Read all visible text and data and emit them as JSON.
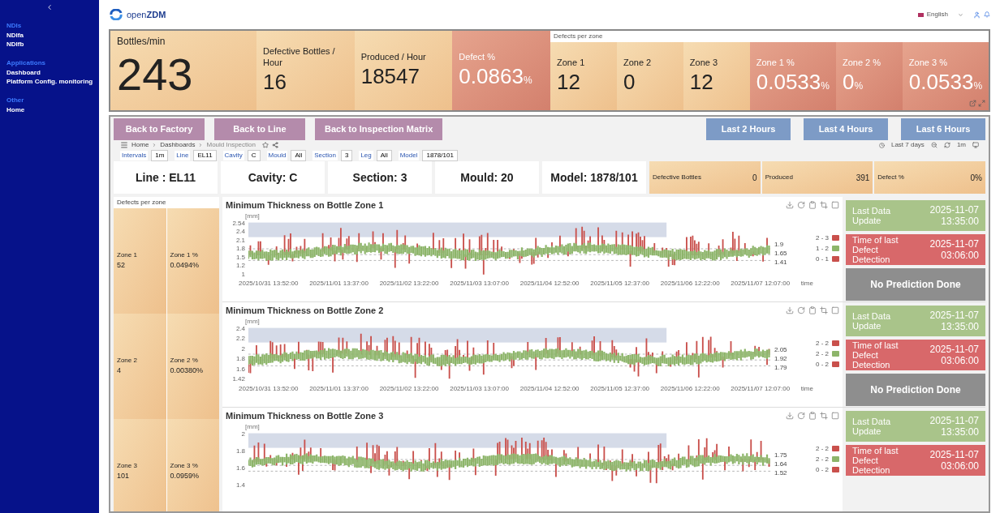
{
  "sidebar": {
    "sections": [
      {
        "title": "NDIs",
        "items": [
          "NDIfa",
          "NDIfb"
        ]
      },
      {
        "title": "Applications",
        "items": [
          "Dashboard",
          "Platform Config. monitoring"
        ]
      },
      {
        "title": "Other",
        "items": [
          "Home"
        ]
      }
    ]
  },
  "header": {
    "logo_light": "open",
    "logo_bold": "ZDM",
    "language": "English"
  },
  "kpis": {
    "main": {
      "label": "Bottles/min",
      "value": "243"
    },
    "tiles": [
      {
        "label": "Defective Bottles / Hour",
        "value": "16",
        "kind": "light"
      },
      {
        "label": "Produced / Hour",
        "value": "18547",
        "kind": "light"
      },
      {
        "label": "Defect %",
        "value": "0.0863",
        "unit": "%",
        "kind": "red"
      }
    ],
    "zones_title": "Defects per zone",
    "zones": [
      {
        "label": "Zone 1",
        "value": "12",
        "kind": "light"
      },
      {
        "label": "Zone 2",
        "value": "0",
        "kind": "light"
      },
      {
        "label": "Zone 3",
        "value": "12",
        "kind": "light"
      },
      {
        "label": "Zone 1 %",
        "value": "0.0533",
        "unit": "%",
        "kind": "red"
      },
      {
        "label": "Zone 2 %",
        "value": "0",
        "unit": "%",
        "kind": "red"
      },
      {
        "label": "Zone 3 %",
        "value": "0.0533",
        "unit": "%",
        "kind": "red"
      }
    ]
  },
  "nav_buttons": [
    {
      "label": "Back to Factory",
      "kind": "back"
    },
    {
      "label": "Back to Line",
      "kind": "back"
    },
    {
      "label": "Back to Inspection Matrix",
      "kind": "back"
    },
    {
      "label": "Last 2 Hours",
      "kind": "range"
    },
    {
      "label": "Last 4 Hours",
      "kind": "range"
    },
    {
      "label": "Last 6 Hours",
      "kind": "range"
    }
  ],
  "breadcrumb": [
    "Home",
    "Dashboards",
    "Mould Inspection"
  ],
  "time_range": "Last 7 days",
  "refresh": "1m",
  "filters": [
    {
      "label": "Intervals",
      "value": "1m"
    },
    {
      "label": "Line",
      "value": "EL11"
    },
    {
      "label": "Cavity",
      "value": "C"
    },
    {
      "label": "Mould",
      "value": "All"
    },
    {
      "label": "Section",
      "value": "3"
    },
    {
      "label": "Leg",
      "value": "All"
    },
    {
      "label": "Model",
      "value": "1878/101"
    }
  ],
  "info": [
    "Line : EL11",
    "Cavity: C",
    "Section: 3",
    "Mould: 20",
    "Model: 1878/101"
  ],
  "stats": [
    {
      "label": "Defective Bottles",
      "value": "0"
    },
    {
      "label": "Produced",
      "value": "391"
    },
    {
      "label": "Defect %",
      "value": "0%"
    }
  ],
  "zone_panel": {
    "title": "Defects per zone",
    "rows": [
      {
        "label": "Zone 1",
        "value": "52",
        "pct_label": "Zone 1 %",
        "pct": "0.0494%"
      },
      {
        "label": "Zone 2",
        "value": "4",
        "pct_label": "Zone 2 %",
        "pct": "0.00380%"
      },
      {
        "label": "Zone 3",
        "value": "101",
        "pct_label": "Zone 3 %",
        "pct": "0.0959%"
      }
    ]
  },
  "charts": [
    {
      "title": "Minimum Thickness on Bottle Zone 1",
      "unit": "[mm]",
      "yticks": [
        "2.54",
        "2.4",
        "2.1",
        "1.8",
        "1.5",
        "1.2",
        "1"
      ],
      "xticks": [
        "2025/10/31 13:52:00",
        "2025/11/01 13:37:00",
        "2025/11/02 13:22:00",
        "2025/11/03 13:07:00",
        "2025/11/04 12:52:00",
        "2025/11/05 12:37:00",
        "2025/11/06 12:22:00",
        "2025/11/07 12:07:00"
      ],
      "x_label": "time",
      "thresholds": [
        "1.9",
        "1.65",
        "1.41"
      ],
      "legend": [
        {
          "label": "2 - 3",
          "color": "#c9504c"
        },
        {
          "label": "1 - 2",
          "color": "#8db56a"
        },
        {
          "label": "0 - 1",
          "color": "#c9504c"
        }
      ],
      "status": [
        {
          "label": "Last Data Update",
          "value": "2025-11-07 13:35:00",
          "kind": "ok"
        },
        {
          "label": "Time of last Defect Detection",
          "value": "2025-11-07 03:06:00",
          "kind": "alert"
        },
        {
          "label": "No Prediction Done",
          "kind": "none"
        }
      ]
    },
    {
      "title": "Minimum Thickness on Bottle Zone 2",
      "unit": "[mm]",
      "yticks": [
        "2.4",
        "2.2",
        "2",
        "1.8",
        "1.6",
        "1.42"
      ],
      "xticks": [
        "2025/10/31 13:52:00",
        "2025/11/01 13:37:00",
        "2025/11/02 13:22:00",
        "2025/11/03 13:07:00",
        "2025/11/04 12:52:00",
        "2025/11/05 12:37:00",
        "2025/11/06 12:22:00",
        "2025/11/07 12:07:00"
      ],
      "x_label": "time",
      "thresholds": [
        "2.05",
        "1.92",
        "1.79"
      ],
      "legend": [
        {
          "label": "2 - 2",
          "color": "#c9504c"
        },
        {
          "label": "2 - 2",
          "color": "#8db56a"
        },
        {
          "label": "0 - 2",
          "color": "#c9504c"
        }
      ],
      "status": [
        {
          "label": "Last Data Update",
          "value": "2025-11-07 13:35:00",
          "kind": "ok"
        },
        {
          "label": "Time of last Defect Detection",
          "value": "2025-11-07 03:06:00",
          "kind": "alert"
        },
        {
          "label": "No Prediction Done",
          "kind": "none"
        }
      ]
    },
    {
      "title": "Minimum Thickness on Bottle Zone 3",
      "unit": "[mm]",
      "yticks": [
        "2",
        "1.8",
        "1.6",
        "1.4"
      ],
      "thresholds": [
        "1.75",
        "1.64",
        "1.52"
      ],
      "legend": [
        {
          "label": "2 - 2",
          "color": "#c9504c"
        },
        {
          "label": "2 - 2",
          "color": "#8db56a"
        },
        {
          "label": "0 - 2",
          "color": "#c9504c"
        }
      ],
      "status": [
        {
          "label": "Last Data Update",
          "value": "2025-11-07 13:35:00",
          "kind": "ok"
        },
        {
          "label": "Time of last Defect Detection",
          "value": "2025-11-07 03:06:00",
          "kind": "alert"
        }
      ]
    }
  ]
}
